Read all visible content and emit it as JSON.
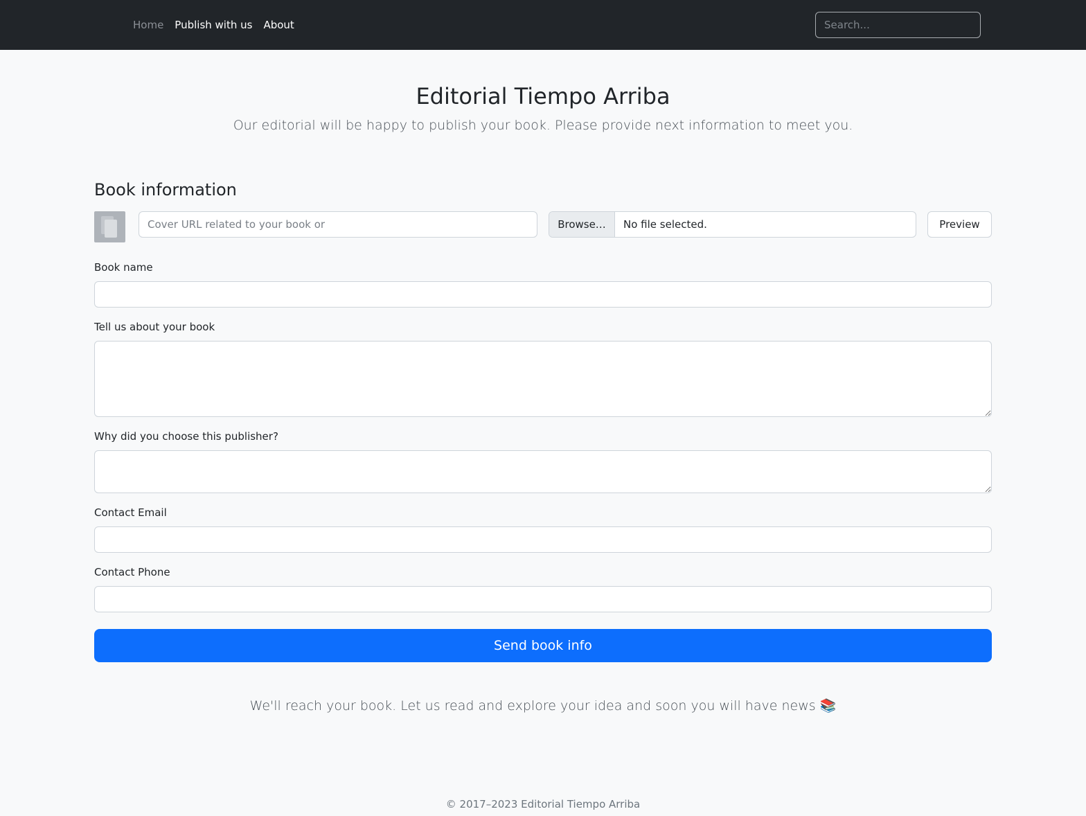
{
  "navbar": {
    "links": [
      "Home",
      "Publish with us",
      "About"
    ],
    "search_placeholder": "Search..."
  },
  "hero": {
    "title": "Editorial Tiempo Arriba",
    "subtitle": "Our editorial will be happy to publish your book. Please provide next information to meet you."
  },
  "form": {
    "section_title": "Book information",
    "cover_url_placeholder": "Cover URL related to your book or",
    "browse_label": "Browse…",
    "file_status": "No file selected.",
    "preview_label": "Preview",
    "book_name_label": "Book name",
    "about_label": "Tell us about your book",
    "why_label": "Why did you choose this publisher?",
    "email_label": "Contact Email",
    "phone_label": "Contact Phone",
    "submit_label": "Send book info"
  },
  "closing_note": "We'll reach your book. Let us read and explore your idea and soon you will have news 📚",
  "footer": "© 2017–2023 Editorial Tiempo Arriba",
  "colors": {
    "navbar_bg": "#212529",
    "page_bg": "#f8f9fa",
    "primary": "#0d6efd"
  }
}
